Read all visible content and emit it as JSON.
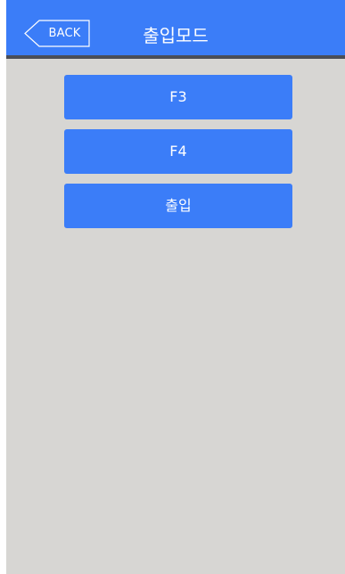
{
  "header": {
    "back_label": "BACK",
    "title": "출입모드",
    "back_icon": "chevron-left-outline-icon"
  },
  "menu": {
    "items": [
      {
        "label": "F3"
      },
      {
        "label": "F4"
      },
      {
        "label": "출입"
      }
    ]
  },
  "colors": {
    "accent": "#3b7df8",
    "background": "#d7d6d3",
    "header_border": "#4a4d57"
  }
}
